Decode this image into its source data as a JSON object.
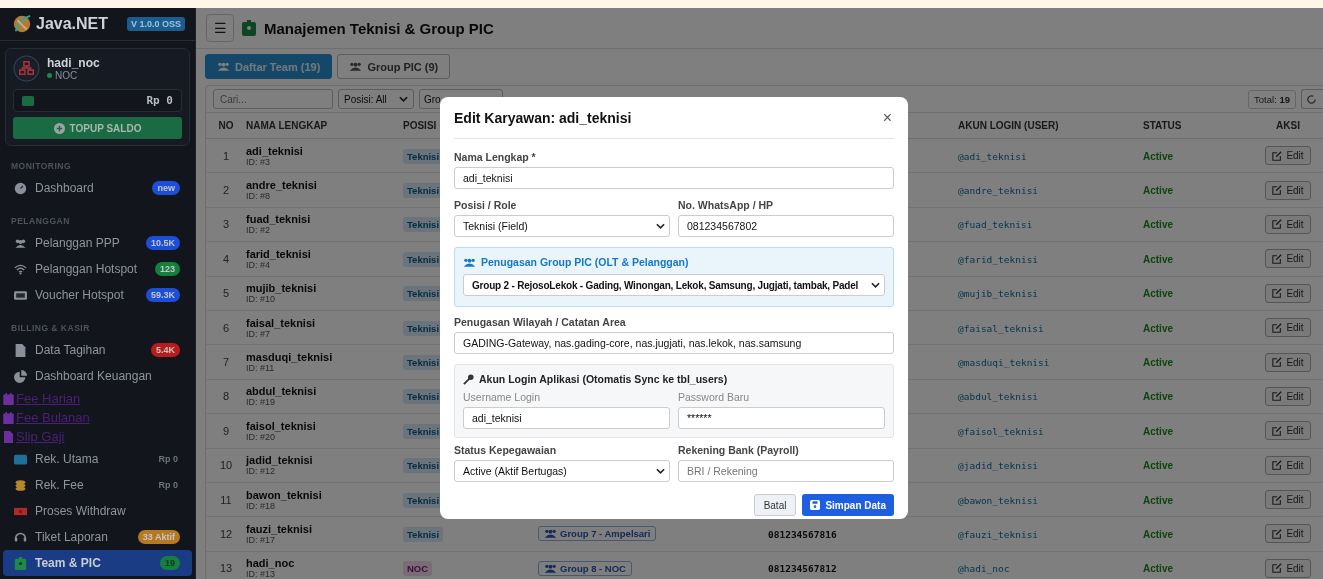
{
  "sidebar": {
    "brand": "Java.NET",
    "version": "V 1.0.0 OSS",
    "user": {
      "name": "hadi_noc",
      "role": "NOC",
      "balance": "Rp 0",
      "topup": "TOPUP SALDO"
    },
    "sections": [
      {
        "title": "MONITORING",
        "items": [
          {
            "kind": "nav",
            "label": "Dashboard",
            "badge": "new",
            "color": "#1d4ed8",
            "selected": false
          }
        ]
      },
      {
        "title": "PELANGGAN",
        "items": [
          {
            "kind": "nav",
            "label": "Pelanggan PPP",
            "badge": "10.5K",
            "color": "#1d4ed8",
            "selected": false
          },
          {
            "kind": "nav",
            "label": "Pelanggan Hotspot",
            "badge": "123",
            "color": "#15803d",
            "selected": false
          },
          {
            "kind": "nav",
            "label": "Voucher Hotspot",
            "badge": "59.3K",
            "color": "#1d4ed8",
            "selected": false
          }
        ]
      },
      {
        "title": "BILLING & KASIR",
        "items": [
          {
            "kind": "nav",
            "label": "Data Tagihan",
            "badge": "5.4K",
            "color": "#b91c1c",
            "selected": false
          },
          {
            "kind": "nav",
            "label": "Dashboard Keuangan",
            "selected": false
          },
          {
            "kind": "link",
            "label": "Fee Harian"
          },
          {
            "kind": "link",
            "label": "Fee Bulanan"
          },
          {
            "kind": "link",
            "label": "Slip Gaji"
          },
          {
            "kind": "nav",
            "label": "Rek. Utama",
            "amount": "Rp 0",
            "selected": false
          },
          {
            "kind": "nav",
            "label": "Rek. Fee",
            "amount": "Rp 0",
            "selected": false
          },
          {
            "kind": "nav",
            "label": "Proses Withdraw",
            "selected": false
          },
          {
            "kind": "nav",
            "label": "Tiket Laporan",
            "badge": "33 Aktif",
            "color": "#b7791f",
            "selected": false
          },
          {
            "kind": "nav",
            "label": "Team & PIC",
            "badge": "19",
            "color": "#15803d",
            "selected": true
          }
        ]
      }
    ]
  },
  "header": {
    "menu": "☰",
    "title": "Manajemen Teknisi & Group PIC"
  },
  "tabs": [
    {
      "label": "Daftar Team (19)",
      "selected": true
    },
    {
      "label": "Group PIC (9)",
      "selected": false
    }
  ],
  "filters": {
    "search_placeholder": "Cari...",
    "position": "Posisi: All",
    "group": "Gro",
    "total_label": "Total:",
    "total": "19"
  },
  "table": {
    "columns": [
      "NO",
      "NAMA LENGKAP",
      "POSISI",
      "AKUN LOGIN (USER)",
      "STATUS",
      "AKSI"
    ],
    "rows": [
      {
        "no": "1",
        "name": "adi_teknisi",
        "id": "ID: #3",
        "position": "Teknisi",
        "kind": "teknisi",
        "login": "@adi_teknisi",
        "status": "Active",
        "action": "Edit"
      },
      {
        "no": "2",
        "name": "andre_teknisi",
        "id": "ID: #8",
        "position": "Teknisi",
        "kind": "teknisi",
        "login": "@andre_teknisi",
        "status": "Active",
        "action": "Edit"
      },
      {
        "no": "3",
        "name": "fuad_teknisi",
        "id": "ID: #2",
        "position": "Teknisi",
        "kind": "teknisi",
        "login": "@fuad_teknisi",
        "status": "Active",
        "action": "Edit"
      },
      {
        "no": "4",
        "name": "farid_teknisi",
        "id": "ID: #4",
        "position": "Teknisi",
        "kind": "teknisi",
        "login": "@farid_teknisi",
        "status": "Active",
        "action": "Edit"
      },
      {
        "no": "5",
        "name": "mujib_teknisi",
        "id": "ID: #10",
        "position": "Teknisi",
        "kind": "teknisi",
        "login": "@mujib_teknisi",
        "status": "Active",
        "action": "Edit"
      },
      {
        "no": "6",
        "name": "faisal_teknisi",
        "id": "ID: #7",
        "position": "Teknisi",
        "kind": "teknisi",
        "login": "@faisal_teknisi",
        "status": "Active",
        "action": "Edit"
      },
      {
        "no": "7",
        "name": "masduqi_teknisi",
        "id": "ID: #11",
        "position": "Teknisi",
        "kind": "teknisi",
        "login": "@masduqi_teknisi",
        "status": "Active",
        "action": "Edit"
      },
      {
        "no": "8",
        "name": "abdul_teknisi",
        "id": "ID: #19",
        "position": "Teknisi",
        "kind": "teknisi",
        "login": "@abdul_teknisi",
        "status": "Active",
        "action": "Edit"
      },
      {
        "no": "9",
        "name": "faisol_teknisi",
        "id": "ID: #20",
        "position": "Teknisi",
        "kind": "teknisi",
        "login": "@faisol_teknisi",
        "status": "Active",
        "action": "Edit"
      },
      {
        "no": "10",
        "name": "jadid_teknisi",
        "id": "ID: #12",
        "position": "Teknisi",
        "kind": "teknisi",
        "login": "@jadid_teknisi",
        "status": "Active",
        "action": "Edit"
      },
      {
        "no": "11",
        "name": "bawon_teknisi",
        "id": "ID: #18",
        "position": "Teknisi",
        "kind": "teknisi",
        "login": "@bawon_teknisi",
        "status": "Active",
        "action": "Edit"
      },
      {
        "no": "12",
        "name": "fauzi_teknisi",
        "id": "ID: #17",
        "position": "Teknisi",
        "kind": "teknisi",
        "group": "Group 7 - Ampelsari",
        "phone": "081234567816",
        "login": "@fauzi_teknisi",
        "status": "Active",
        "action": "Edit"
      },
      {
        "no": "13",
        "name": "hadi_noc",
        "id": "ID: #13",
        "position": "NOC",
        "kind": "noc",
        "group": "Group 8 - NOC",
        "phone": "081234567812",
        "login": "@hadi_noc",
        "status": "Active",
        "action": "Edit"
      }
    ]
  },
  "modal": {
    "title": "Edit Karyawan: adi_teknisi",
    "close": "×",
    "name_label": "Nama Lengkap *",
    "name_value": "adi_teknisi",
    "role_label": "Posisi / Role",
    "role_value": "Teknisi (Field)",
    "phone_label": "No. WhatsApp / HP",
    "phone_value": "081234567802",
    "group_title": "Penugasan Group PIC (OLT & Pelanggan)",
    "group_value": "Group 2 - RejosoLekok - Gading, Winongan, Lekok, Samsung, Jugjati, tambak, Padel",
    "area_label": "Penugasan Wilayah / Catatan Area",
    "area_value": "GADING-Gateway, nas.gading-core, nas.jugjati, nas.lekok, nas.samsung",
    "login_title": "Akun Login Aplikasi (Otomatis Sync ke tbl_users)",
    "username_label": "Username Login",
    "username_value": "adi_teknisi",
    "password_label": "Password Baru",
    "password_value": "******",
    "status_label": "Status Kepegawaian",
    "status_value": "Active (Aktif Bertugas)",
    "bank_label": "Rekening Bank (Payroll)",
    "bank_placeholder": "BRI / Rekening",
    "cancel": "Batal",
    "save": "Simpan Data"
  }
}
